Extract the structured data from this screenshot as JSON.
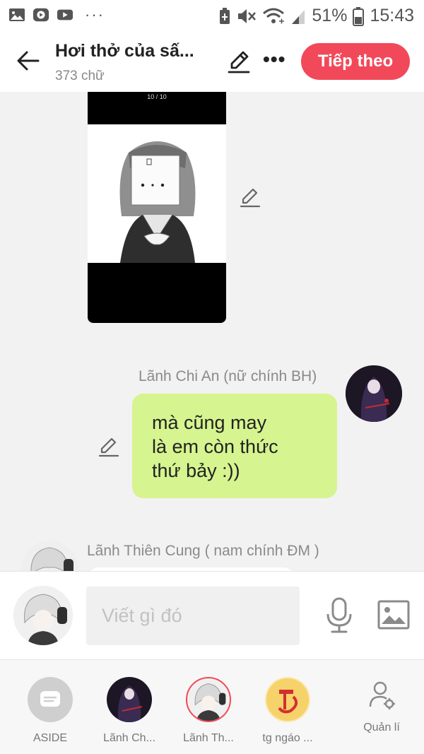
{
  "status_bar": {
    "battery": "51%",
    "time": "15:43",
    "icons": [
      "gallery-icon",
      "youtube-studio-icon",
      "youtube-icon",
      "more-notifications-icon",
      "battery-saver-icon",
      "mute-icon",
      "wifi-icon",
      "signal-icon",
      "battery-icon"
    ]
  },
  "header": {
    "title": "Hơi thở của sấ...",
    "word_count": "373 chữ",
    "next_label": "Tiếp theo",
    "more_label": "•••"
  },
  "chat": {
    "image_counter": "10 / 10",
    "messages": [
      {
        "sender": "Lãnh Chi An (nữ chính BH)",
        "lines": [
          "mà cũng may",
          "là em còn thức",
          "thứ bảy :))"
        ]
      },
      {
        "sender": "Lãnh Thiên Cung ( nam chính ĐM )"
      }
    ]
  },
  "input": {
    "placeholder": "Viết gì đó"
  },
  "characters": [
    {
      "label": "ASIDE"
    },
    {
      "label": "Lãnh Ch..."
    },
    {
      "label": "Lãnh Th..."
    },
    {
      "label": "tg ngáo ..."
    },
    {
      "label": "Quản lí"
    }
  ],
  "colors": {
    "accent": "#f2495a",
    "bubble": "#d6f48f"
  }
}
